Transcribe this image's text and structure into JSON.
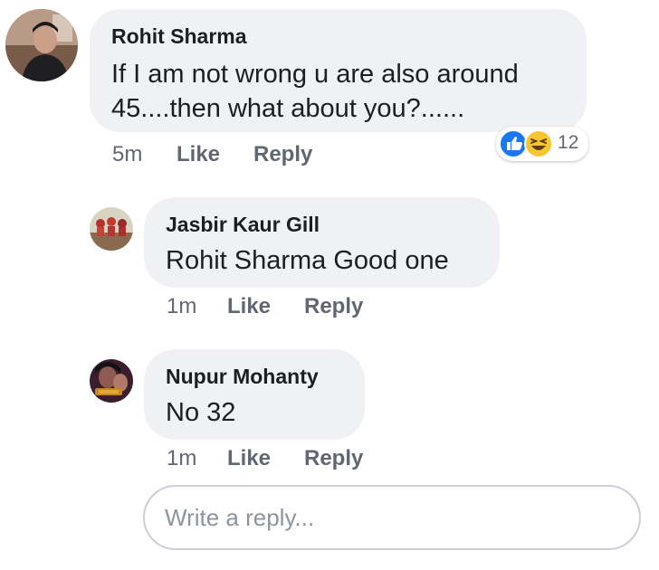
{
  "comments": [
    {
      "author": "Rohit Sharma",
      "text_lines": [
        "If I am not wrong u are also around",
        "45....then what about you?......"
      ],
      "time": "5m",
      "like_label": "Like",
      "reply_label": "Reply",
      "reaction_count": "12",
      "reaction_icons": [
        "like-icon",
        "laugh-icon"
      ]
    },
    {
      "author": "Jasbir Kaur Gill",
      "text": "Rohit Sharma Good one",
      "time": "1m",
      "like_label": "Like",
      "reply_label": "Reply"
    },
    {
      "author": "Nupur Mohanty",
      "text": "No 32",
      "time": "1m",
      "like_label": "Like",
      "reply_label": "Reply"
    }
  ],
  "reply_box": {
    "placeholder": "Write a reply..."
  },
  "colors": {
    "bubble_bg": "#f0f1f4",
    "meta_text": "#616770",
    "like_blue": "#1877f2",
    "laugh_yellow": "#f7c532"
  }
}
